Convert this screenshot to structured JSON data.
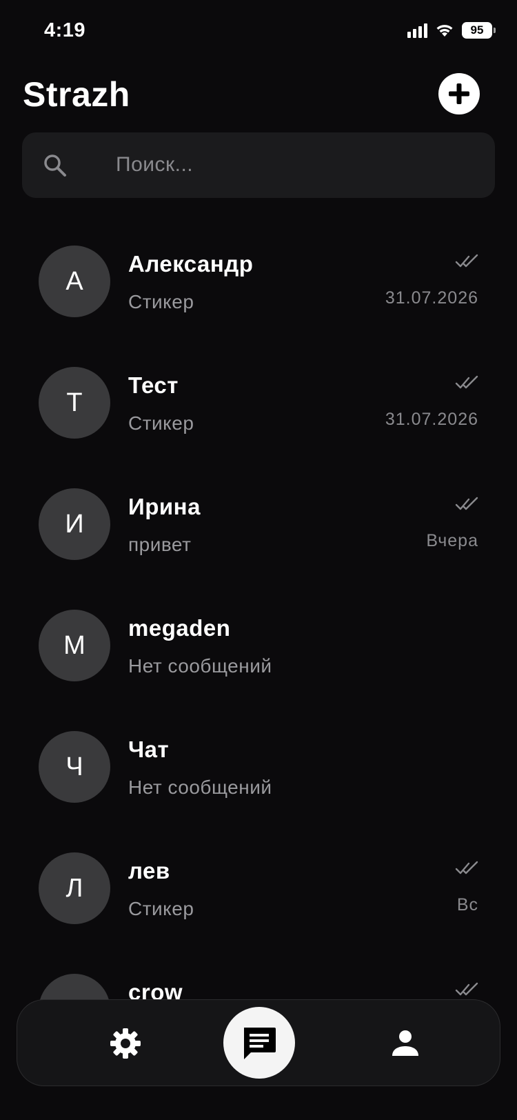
{
  "status_bar": {
    "time": "4:19",
    "battery": "95",
    "signal_icon": "cellular-signal-icon",
    "wifi_icon": "wifi-icon"
  },
  "header": {
    "title": "Strazh",
    "add_icon": "plus-circle-icon"
  },
  "search": {
    "placeholder": "Поиск...",
    "value": ""
  },
  "chats": [
    {
      "initial": "А",
      "name": "Александр",
      "preview": "Стикер",
      "time": "31.07.2026",
      "read": true
    },
    {
      "initial": "Т",
      "name": "Тест",
      "preview": "Стикер",
      "time": "31.07.2026",
      "read": true
    },
    {
      "initial": "И",
      "name": "Ирина",
      "preview": "привет",
      "time": "Вчера",
      "read": true
    },
    {
      "initial": "M",
      "name": "megaden",
      "preview": "Нет сообщений",
      "time": "",
      "read": false
    },
    {
      "initial": "Ч",
      "name": "Чат",
      "preview": "Нет сообщений",
      "time": "",
      "read": false
    },
    {
      "initial": "Л",
      "name": "лев",
      "preview": "Стикер",
      "time": "Вс",
      "read": true
    },
    {
      "initial": "",
      "name": "crow",
      "preview": "",
      "time": "",
      "read": true
    }
  ],
  "bottom_nav": {
    "items": [
      {
        "id": "settings",
        "icon": "gear-icon",
        "active": false
      },
      {
        "id": "chats",
        "icon": "chat-bubble-icon",
        "active": true
      },
      {
        "id": "profile",
        "icon": "person-icon",
        "active": false
      }
    ]
  },
  "colors": {
    "background": "#0b0a0c",
    "surface": "#1b1b1d",
    "avatar": "#3a3a3c",
    "secondary_text": "#9a9a9e",
    "accent": "#ffffff"
  }
}
